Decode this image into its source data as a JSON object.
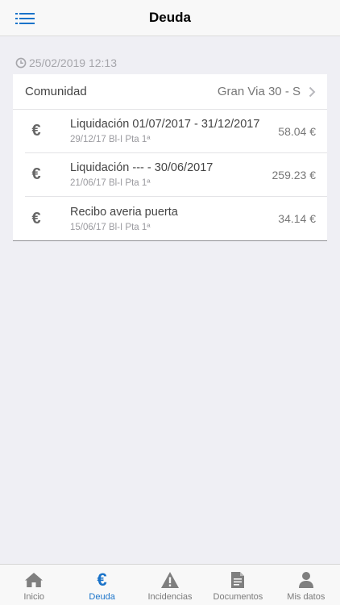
{
  "header": {
    "title": "Deuda",
    "menu_icon": "list-icon"
  },
  "timestamp": {
    "text": "25/02/2019 12:13",
    "icon": "clock-icon"
  },
  "community": {
    "label": "Comunidad",
    "value": "Gran Via 30 - S",
    "icon": "chevron-right-icon"
  },
  "items": [
    {
      "icon": "euro-icon",
      "title": "Liquidación 01/07/2017 - 31/12/2017",
      "subtitle": "29/12/17 Bl-I Pta 1ª",
      "amount": "58.04 €"
    },
    {
      "icon": "euro-icon",
      "title": "Liquidación --- - 30/06/2017",
      "subtitle": "21/06/17 Bl-I Pta 1ª",
      "amount": "259.23 €"
    },
    {
      "icon": "euro-icon",
      "title": "Recibo averia puerta",
      "subtitle": "15/06/17 Bl-I Pta 1ª",
      "amount": "34.14 €"
    }
  ],
  "tabs": [
    {
      "label": "Inicio",
      "icon": "home-icon",
      "active": false
    },
    {
      "label": "Deuda",
      "icon": "euro-icon",
      "active": true
    },
    {
      "label": "Incidencias",
      "icon": "warning-icon",
      "active": false
    },
    {
      "label": "Documentos",
      "icon": "document-icon",
      "active": false
    },
    {
      "label": "Mis datos",
      "icon": "user-icon",
      "active": false
    }
  ],
  "colors": {
    "accent": "#1a73c9",
    "background": "#efeff4",
    "icon_gray": "#666666"
  }
}
